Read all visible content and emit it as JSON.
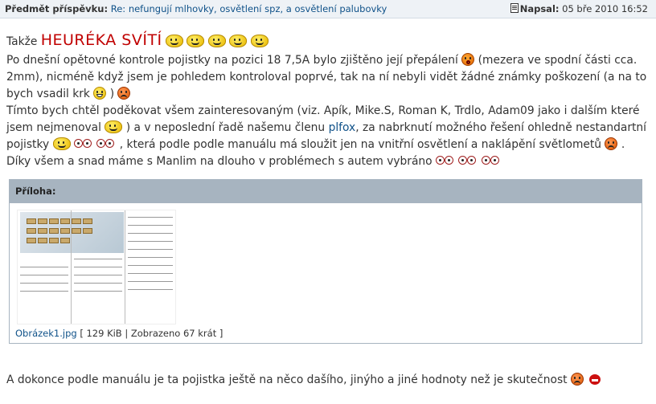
{
  "post_header": {
    "subject_label": "Předmět příspěvku:",
    "subject": "Re: nefungují mlhovky, osvětlení spz, a osvětlení palubovky",
    "posted_label": "Napsal:",
    "posted_date": "05 bře 2010 16:52"
  },
  "body": {
    "intro": "Takže",
    "headline": "HEURÉKA SVÍTÍ",
    "p1": "Po dnešní opětovné kontrole pojistky na pozici 18 7,5A bylo zjištěno její přepálení",
    "p1b": "(mezera ve spodní části cca. 2mm), nicméně když jsem je pohledem kontroloval poprvé, tak na ní nebyli vidět žádné známky poškození (a na to bych vsadil krk",
    "p1c": ")",
    "p2": "Tímto bych chtěl poděkovat všem zainteresovaným (viz. Apík, Mike.S, Roman K, Trdlo, Adam09 jako i dalším které jsem nejmenoval",
    "p2b": ") a v neposlední řadě našemu členu",
    "member": "plfox",
    "p2c": ", za nabrknutí možného řešení ohledně nestandartní pojistky",
    "p2d": ", která podle podle manuálu má sloužit jen na vnitřní osvětlení a naklápění světlometů",
    "p2e": ".",
    "p3": "Díky všem a snad máme s Manlim na dlouho v problémech s autem vybráno"
  },
  "attachment": {
    "label": "Příloha:",
    "filename": "Obrázek1.jpg",
    "meta": "[ 129 KiB | Zobrazeno 67 krát ]"
  },
  "footer_text": "A dokonce podle manuálu je ta pojistka ještě na něco dašího, jinýho a jiné hodnoty než je skutečnost",
  "icons": {
    "post": "document-icon",
    "smileys": [
      "wave-smiley",
      "shock-smiley",
      "grin-smiley",
      "sad-smiley",
      "nuts-smiley",
      "devil-smiley"
    ]
  },
  "colors": {
    "header_bg": "#eef2f6",
    "link": "#105289",
    "headline": "#c00000",
    "attach_head": "#a7b4c0"
  }
}
